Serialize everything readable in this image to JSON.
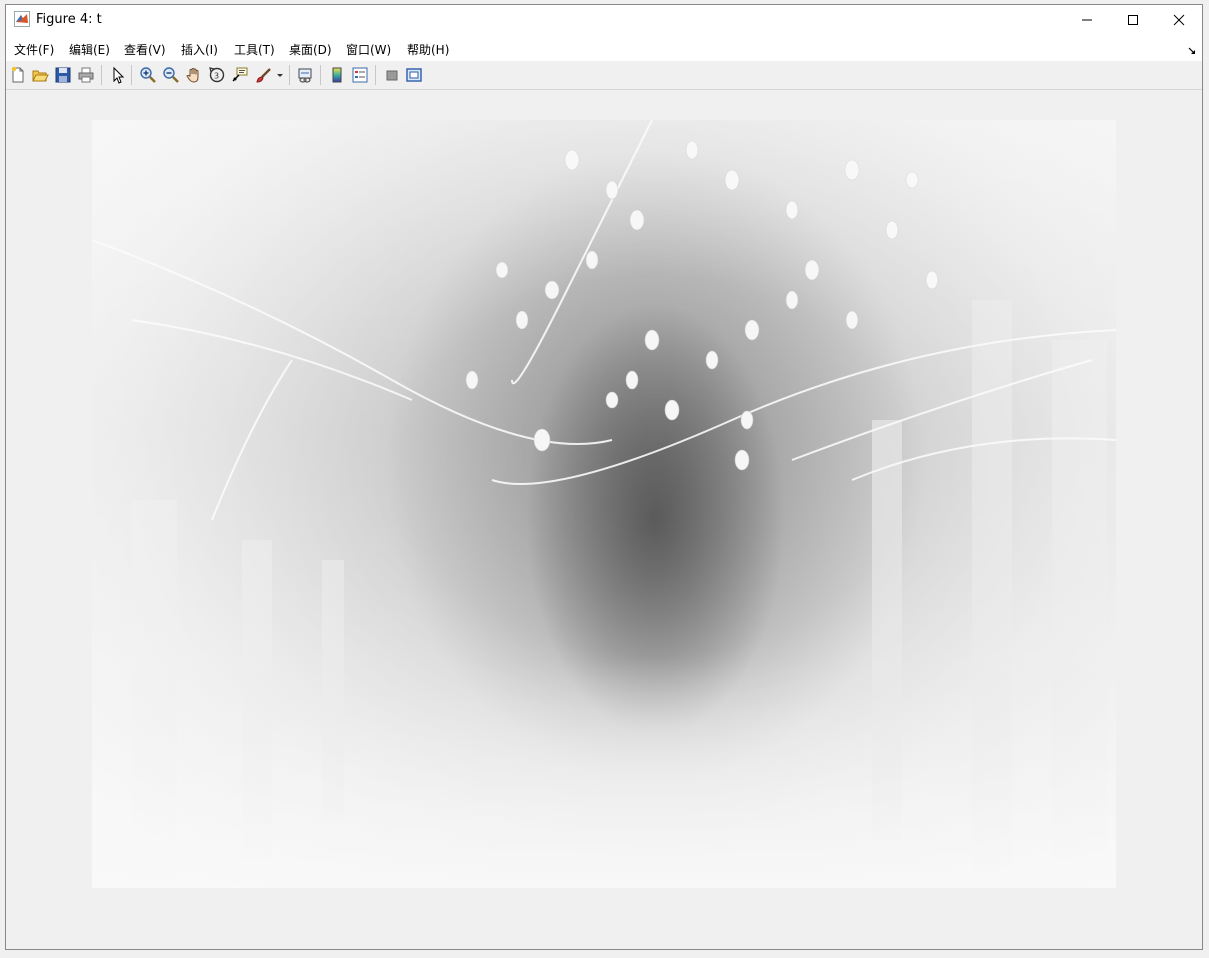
{
  "window": {
    "title": "Figure 4: t",
    "controls": {
      "minimize_icon": "minimize-icon",
      "maximize_icon": "maximize-icon",
      "close_icon": "close-icon"
    }
  },
  "menubar": {
    "items": [
      {
        "label": "文件(F)"
      },
      {
        "label": "编辑(E)"
      },
      {
        "label": "查看(V)"
      },
      {
        "label": "插入(I)"
      },
      {
        "label": "工具(T)"
      },
      {
        "label": "桌面(D)"
      },
      {
        "label": "窗口(W)"
      },
      {
        "label": "帮助(H)"
      }
    ]
  },
  "toolbar": {
    "icons": [
      "new-figure-icon",
      "open-file-icon",
      "save-icon",
      "print-icon",
      "edit-plot-arrow-icon",
      "zoom-in-icon",
      "zoom-out-icon",
      "pan-hand-icon",
      "rotate-3d-icon",
      "data-cursor-icon",
      "brush-icon",
      "brush-dropdown-icon",
      "link-plot-icon",
      "colorbar-icon",
      "legend-icon",
      "hide-plot-tools-icon",
      "show-plot-tools-icon"
    ]
  },
  "figure": {
    "image_desc": "grayscale-inverted-forest-image"
  }
}
